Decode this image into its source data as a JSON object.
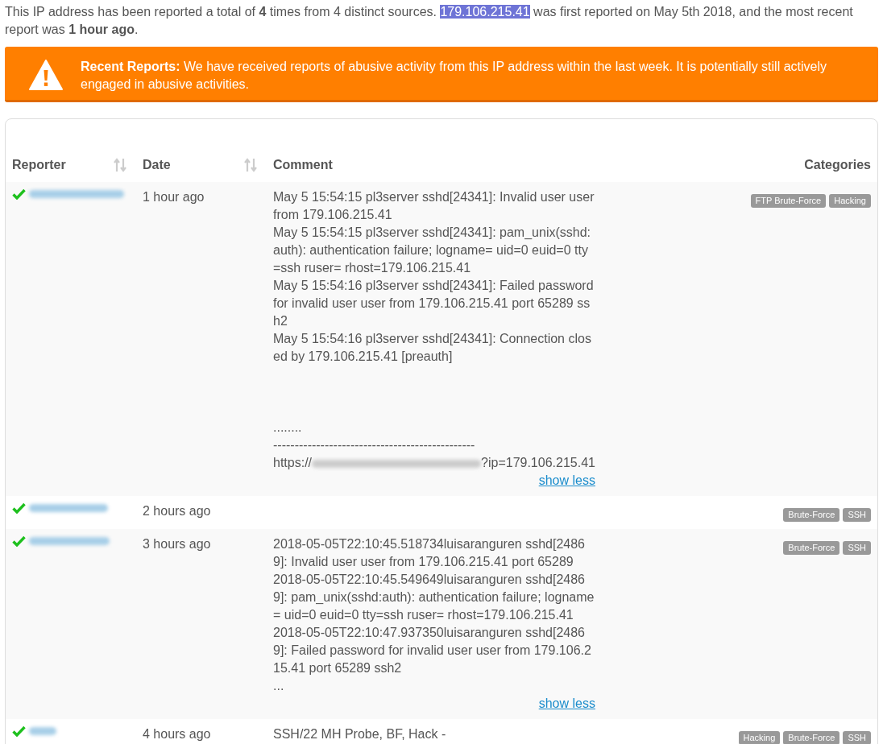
{
  "summary": {
    "before": "This IP address has been reported a total of **4** times from 4 distinct sources. ",
    "selected_text": "179.106.215.41",
    "after": " was first reported on May 5th 2018, and the most recent report was **1 hour ago**."
  },
  "alert": {
    "title": "Recent Reports:",
    "text": "We have received reports of abusive activity from this IP address within the last week. It is potentially still actively engaged in abusive activities."
  },
  "table": {
    "columns": [
      {
        "label": "Reporter",
        "sortable": true
      },
      {
        "label": "Date",
        "sortable": true
      },
      {
        "label": "Comment"
      },
      {
        "label": "Categories"
      }
    ],
    "rows": [
      {
        "verified": true,
        "date": "1 hour ago",
        "comment": [
          {
            "kind": "text",
            "text": "May 5 15:54:15 pl3server sshd[24341]: Invalid user user"
          },
          {
            "kind": "text",
            "text": "from 179.106.215.41"
          },
          {
            "kind": "text",
            "text": "May 5 15:54:15 pl3server sshd[24341]: pam_unix(sshd:"
          },
          {
            "kind": "text",
            "text": "auth): authentication failure; logname= uid=0 euid=0 tty"
          },
          {
            "kind": "text",
            "text": "=ssh ruser= rhost=179.106.215.41"
          },
          {
            "kind": "text",
            "text": "May 5 15:54:16 pl3server sshd[24341]: Failed password"
          },
          {
            "kind": "text",
            "text": "for invalid user user from 179.106.215.41 port 65289 ss"
          },
          {
            "kind": "text",
            "text": "h2"
          },
          {
            "kind": "text",
            "text": "May 5 15:54:16 pl3server sshd[24341]: Connection clos"
          },
          {
            "kind": "text",
            "text": "ed by 179.106.215.41 [preauth]"
          },
          {
            "kind": "blank"
          },
          {
            "kind": "blank"
          },
          {
            "kind": "blank"
          },
          {
            "kind": "text",
            "text": "........"
          },
          {
            "kind": "text",
            "text": "-----------------------------------------------"
          },
          {
            "kind": "url",
            "prefix": "https://",
            "suffix": "?ip=179.106.215.41"
          }
        ],
        "toggle": "show less",
        "categories": [
          "FTP Brute-Force",
          "Hacking"
        ]
      },
      {
        "verified": true,
        "date": "2 hours ago",
        "comment": [],
        "categories": [
          "Brute-Force",
          "SSH"
        ]
      },
      {
        "verified": true,
        "date": "3 hours ago",
        "comment": [
          {
            "kind": "text",
            "text": "2018-05-05T22:10:45.518734luisaranguren sshd[2486"
          },
          {
            "kind": "text",
            "text": "9]: Invalid user user from 179.106.215.41 port 65289"
          },
          {
            "kind": "text",
            "text": "2018-05-05T22:10:45.549649luisaranguren sshd[2486"
          },
          {
            "kind": "text",
            "text": "9]: pam_unix(sshd:auth): authentication failure; logname"
          },
          {
            "kind": "text",
            "text": "= uid=0 euid=0 tty=ssh ruser= rhost=179.106.215.41"
          },
          {
            "kind": "text",
            "text": "2018-05-05T22:10:47.937350luisaranguren sshd[2486"
          },
          {
            "kind": "text",
            "text": "9]: Failed password for invalid user user from 179.106.2"
          },
          {
            "kind": "text",
            "text": "15.41 port 65289 ssh2"
          },
          {
            "kind": "text",
            "text": "..."
          }
        ],
        "toggle": "show less",
        "categories": [
          "Brute-Force",
          "SSH"
        ]
      },
      {
        "verified": true,
        "date": "4 hours ago",
        "comment": [
          {
            "kind": "text",
            "text": "SSH/22 MH Probe, BF, Hack -"
          }
        ],
        "categories": [
          "Hacking",
          "Brute-Force",
          "SSH"
        ]
      }
    ]
  }
}
